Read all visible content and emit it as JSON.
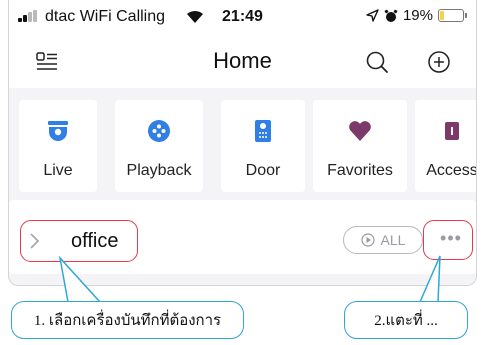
{
  "status_bar": {
    "carrier": "dtac WiFi Calling",
    "time": "21:49",
    "battery_percent": "19%",
    "battery_level": 0.19,
    "icons": [
      "signal-icon",
      "wifi-icon",
      "location-arrow-icon",
      "alarm-icon",
      "battery-icon"
    ]
  },
  "header": {
    "title": "Home",
    "icons": [
      "menu-icon",
      "search-icon",
      "add-icon"
    ]
  },
  "shortcuts": [
    {
      "label": "Live",
      "icon": "camera-icon",
      "color": "#2f7fe6"
    },
    {
      "label": "Playback",
      "icon": "playback-icon",
      "color": "#2f7fe6"
    },
    {
      "label": "Door",
      "icon": "door-icon",
      "color": "#2f7fe6"
    },
    {
      "label": "Favorites",
      "icon": "heart-icon",
      "color": "#7b3a6a"
    },
    {
      "label": "Access",
      "icon": "access-icon",
      "color": "#7b3a6a"
    }
  ],
  "device": {
    "name": "office",
    "all_label": "ALL"
  },
  "annotations": {
    "callout_1": "1. เลือกเครื่องบันทึกที่ต้องการ",
    "callout_2": "2.แตะที่ ...",
    "highlight_color": "#e53950",
    "callout_color": "#2fa6d8"
  }
}
